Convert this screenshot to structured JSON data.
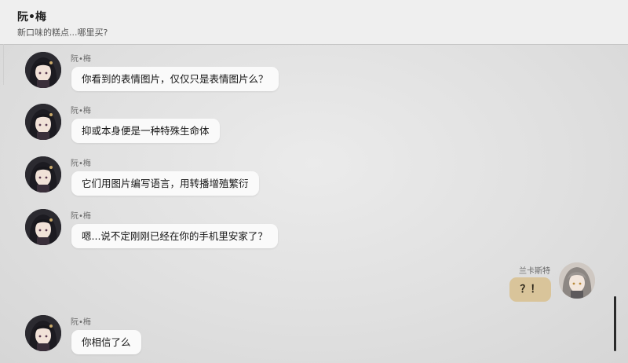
{
  "header": {
    "title": "阮•梅",
    "subtitle": "新口味的糕点...哪里买?"
  },
  "messages": [
    {
      "sender": "阮•梅",
      "side": "left",
      "text": "你看到的表情图片，仅仅只是表情图片么？"
    },
    {
      "sender": "阮•梅",
      "side": "left",
      "text": "抑或本身便是一种特殊生命体"
    },
    {
      "sender": "阮•梅",
      "side": "left",
      "text": "它们用图片编写语言，用转播增殖繁衍"
    },
    {
      "sender": "阮•梅",
      "side": "left",
      "text": "嗯...说不定刚刚已经在你的手机里安家了？"
    },
    {
      "sender": "兰卡斯特",
      "side": "right",
      "text": "？！"
    },
    {
      "sender": "阮•梅",
      "side": "left",
      "text": "你相信了么"
    }
  ],
  "colors": {
    "incoming_bubble": "#fafafa",
    "outgoing_bubble": "#d9c49a",
    "background": "#e3e3e3"
  },
  "icons": {
    "ruan_mei_avatar": "dark-haired-girl-avatar-icon",
    "lancaster_avatar": "silver-haired-girl-avatar-icon"
  }
}
